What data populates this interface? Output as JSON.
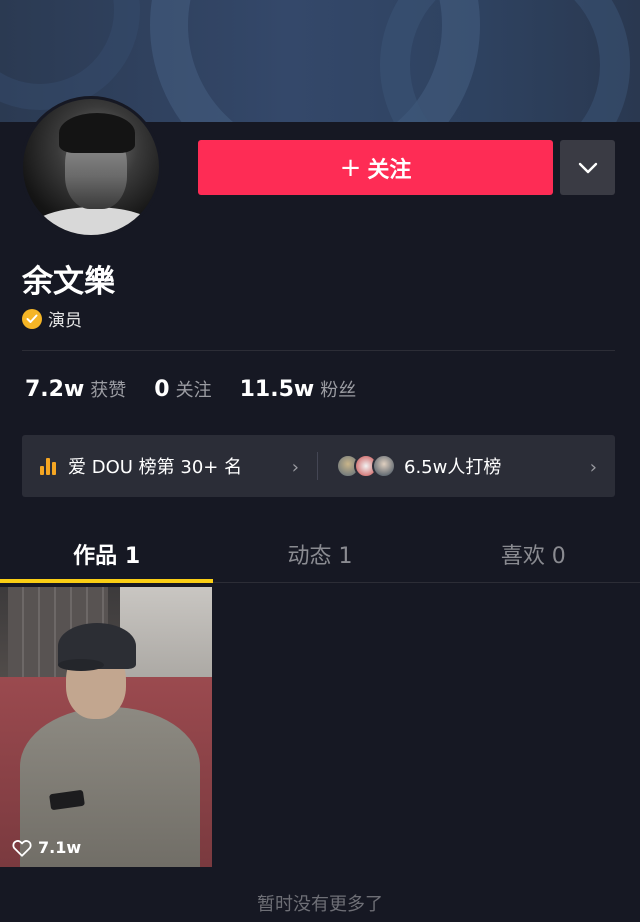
{
  "profile": {
    "name": "余文樂",
    "role": "演员"
  },
  "actions": {
    "follow_plus": "+",
    "follow_label": "关注",
    "more_icon": "chevron-down-icon"
  },
  "stats": [
    {
      "value": "7.2w",
      "label": "获赞"
    },
    {
      "value": "0",
      "label": "关注"
    },
    {
      "value": "11.5w",
      "label": "粉丝"
    }
  ],
  "rank": {
    "left_text": "爱 DOU 榜第 30+ 名",
    "right_text": "6.5w人打榜",
    "chevron": "›"
  },
  "tabs": [
    {
      "label": "作品 1",
      "active": true
    },
    {
      "label": "动态 1",
      "active": false
    },
    {
      "label": "喜欢 0",
      "active": false
    }
  ],
  "videos": [
    {
      "likes": "7.1w"
    }
  ],
  "footer": {
    "no_more": "暂时没有更多了"
  },
  "colors": {
    "background": "#161823",
    "follow_button": "#fe2c55",
    "tab_indicator": "#face15",
    "verified": "#f5b526"
  }
}
